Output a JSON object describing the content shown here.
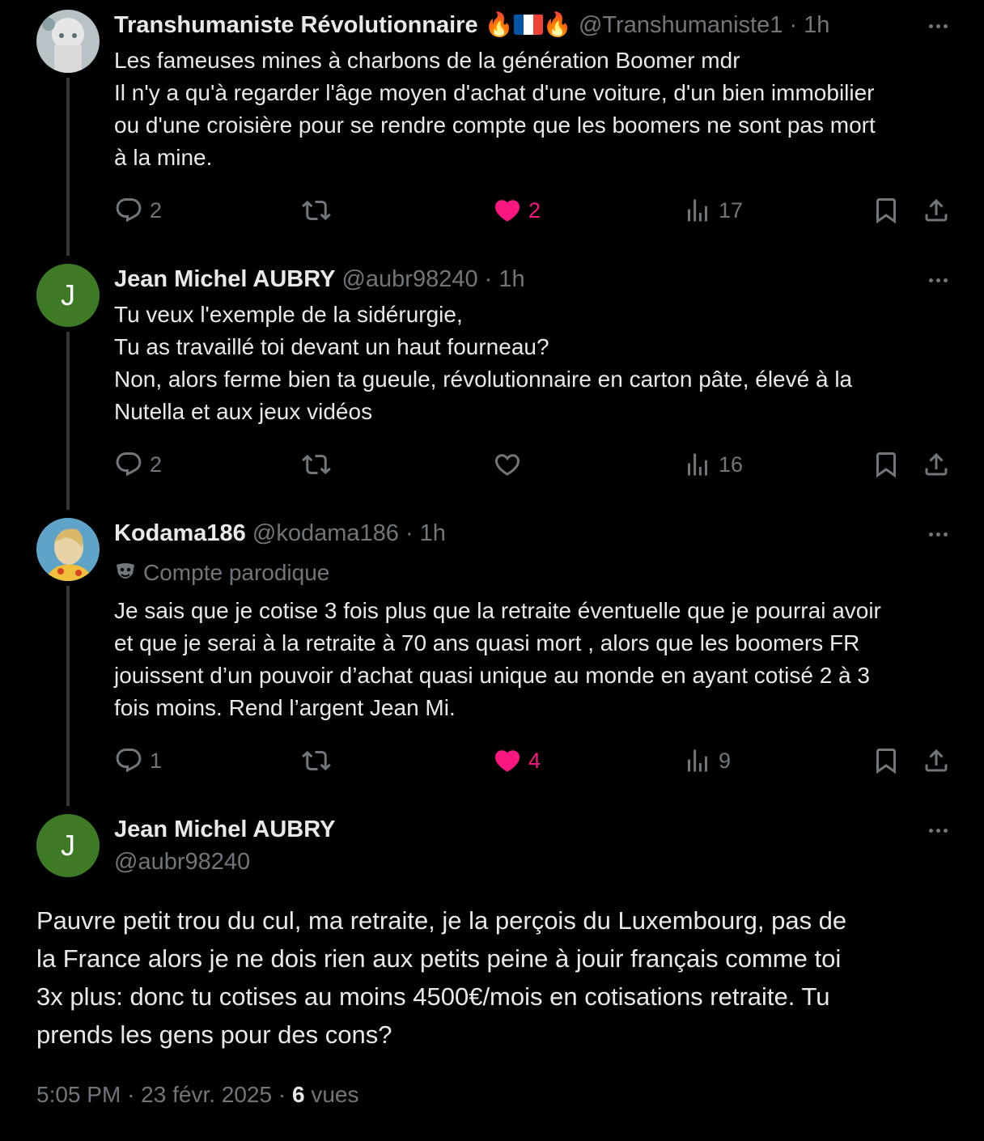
{
  "tweets": [
    {
      "name": "Transhumaniste Révolutionnaire",
      "name_emoji_1": "🔥",
      "name_emoji_2": "🔥",
      "handle": "@Transhumaniste1",
      "sep": "·",
      "time": "1h",
      "lines": [
        "Les fameuses mines à charbons de la génération Boomer mdr",
        "Il n'y a qu'à regarder l'âge moyen d'achat d'une voiture, d'un bien immobilier",
        "ou d'une croisière pour se rendre compte que les boomers ne sont pas mort",
        "à la mine."
      ],
      "replies": "2",
      "retweets": "",
      "likes": "2",
      "views": "17",
      "liked": true
    },
    {
      "name": "Jean Michel AUBRY",
      "handle": "@aubr98240",
      "sep": "·",
      "time": "1h",
      "avatar_letter": "J",
      "lines": [
        "Tu veux l'exemple de la sidérurgie,",
        "Tu as travaillé toi devant un haut fourneau?",
        "Non, alors ferme bien ta gueule, révolutionnaire en carton pâte, élevé à la",
        "Nutella et aux jeux vidéos"
      ],
      "replies": "2",
      "retweets": "",
      "likes": "",
      "views": "16",
      "liked": false
    },
    {
      "name": "Kodama186",
      "handle": "@kodama186",
      "sep": "·",
      "time": "1h",
      "label": "Compte parodique",
      "lines": [
        "Je sais que je cotise 3 fois plus que la retraite éventuelle que je pourrai avoir",
        "et que je serai à la retraite à 70 ans quasi mort , alors que les boomers FR",
        "jouissent d’un pouvoir d’achat quasi unique au monde en ayant cotisé 2 à 3",
        "fois moins. Rend l’argent Jean Mi."
      ],
      "replies": "1",
      "retweets": "",
      "likes": "4",
      "views": "9",
      "liked": true
    }
  ],
  "main": {
    "name": "Jean Michel AUBRY",
    "handle": "@aubr98240",
    "avatar_letter": "J",
    "lines": [
      "Pauvre petit trou du cul, ma retraite, je la perçois du Luxembourg, pas de",
      "la France alors je ne dois rien aux petits peine à jouir français comme toi",
      "3x plus: donc tu cotises au moins 4500€/mois en cotisations retraite. Tu",
      "prends les gens pour des cons?"
    ],
    "time": "5:05 PM",
    "sep1": "·",
    "date": "23 févr. 2025",
    "sep2": "·",
    "views_count": "6",
    "views_label": "vues"
  },
  "colors": {
    "background": "#000000",
    "text": "#e7e9ea",
    "muted": "#71767b",
    "like": "#f91880",
    "avatar_green": "#3e7a26",
    "thread_line": "#333639"
  },
  "icons": [
    "reply-icon",
    "retweet-icon",
    "heart-icon",
    "views-icon",
    "bookmark-icon",
    "share-icon",
    "more-icon",
    "parody-mask-icon",
    "flame-icon",
    "france-flag-icon"
  ]
}
